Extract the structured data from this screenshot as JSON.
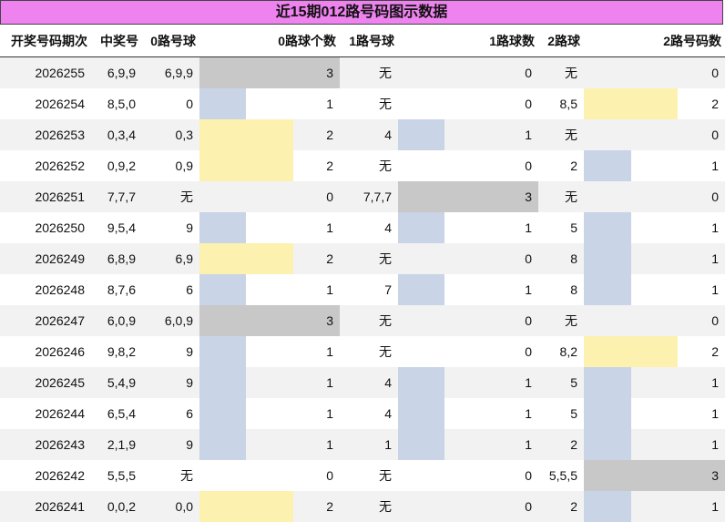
{
  "title": "近15期012路号码图示数据",
  "headers": [
    "开奖号码期次",
    "中奖号",
    "0路号球",
    "0路球个数",
    "1路号球",
    "1路球数",
    "2路球",
    "2路号码数"
  ],
  "colors": {
    "title_bg": "#ee82ee",
    "count_1": "#c9d4e6",
    "count_2": "#fdf1b0",
    "count_3": "#c8c8c8",
    "row_shade": "#f2f2f2"
  },
  "rows": [
    {
      "period": "2026255",
      "number": "6,9,9",
      "road0": "6,9,9",
      "count0": "3",
      "road1": "无",
      "count1": "0",
      "road2": "无",
      "count2": "0"
    },
    {
      "period": "2026254",
      "number": "8,5,0",
      "road0": "0",
      "count0": "1",
      "road1": "无",
      "count1": "0",
      "road2": "8,5",
      "count2": "2"
    },
    {
      "period": "2026253",
      "number": "0,3,4",
      "road0": "0,3",
      "count0": "2",
      "road1": "4",
      "count1": "1",
      "road2": "无",
      "count2": "0"
    },
    {
      "period": "2026252",
      "number": "0,9,2",
      "road0": "0,9",
      "count0": "2",
      "road1": "无",
      "count1": "0",
      "road2": "2",
      "count2": "1"
    },
    {
      "period": "2026251",
      "number": "7,7,7",
      "road0": "无",
      "count0": "0",
      "road1": "7,7,7",
      "count1": "3",
      "road2": "无",
      "count2": "0"
    },
    {
      "period": "2026250",
      "number": "9,5,4",
      "road0": "9",
      "count0": "1",
      "road1": "4",
      "count1": "1",
      "road2": "5",
      "count2": "1"
    },
    {
      "period": "2026249",
      "number": "6,8,9",
      "road0": "6,9",
      "count0": "2",
      "road1": "无",
      "count1": "0",
      "road2": "8",
      "count2": "1"
    },
    {
      "period": "2026248",
      "number": "8,7,6",
      "road0": "6",
      "count0": "1",
      "road1": "7",
      "count1": "1",
      "road2": "8",
      "count2": "1"
    },
    {
      "period": "2026247",
      "number": "6,0,9",
      "road0": "6,0,9",
      "count0": "3",
      "road1": "无",
      "count1": "0",
      "road2": "无",
      "count2": "0"
    },
    {
      "period": "2026246",
      "number": "9,8,2",
      "road0": "9",
      "count0": "1",
      "road1": "无",
      "count1": "0",
      "road2": "8,2",
      "count2": "2"
    },
    {
      "period": "2026245",
      "number": "5,4,9",
      "road0": "9",
      "count0": "1",
      "road1": "4",
      "count1": "1",
      "road2": "5",
      "count2": "1"
    },
    {
      "period": "2026244",
      "number": "6,5,4",
      "road0": "6",
      "count0": "1",
      "road1": "4",
      "count1": "1",
      "road2": "5",
      "count2": "1"
    },
    {
      "period": "2026243",
      "number": "2,1,9",
      "road0": "9",
      "count0": "1",
      "road1": "1",
      "count1": "1",
      "road2": "2",
      "count2": "1"
    },
    {
      "period": "2026242",
      "number": "5,5,5",
      "road0": "无",
      "count0": "0",
      "road1": "无",
      "count1": "0",
      "road2": "5,5,5",
      "count2": "3"
    },
    {
      "period": "2026241",
      "number": "0,0,2",
      "road0": "0,0",
      "count0": "2",
      "road1": "无",
      "count1": "0",
      "road2": "2",
      "count2": "1"
    }
  ]
}
